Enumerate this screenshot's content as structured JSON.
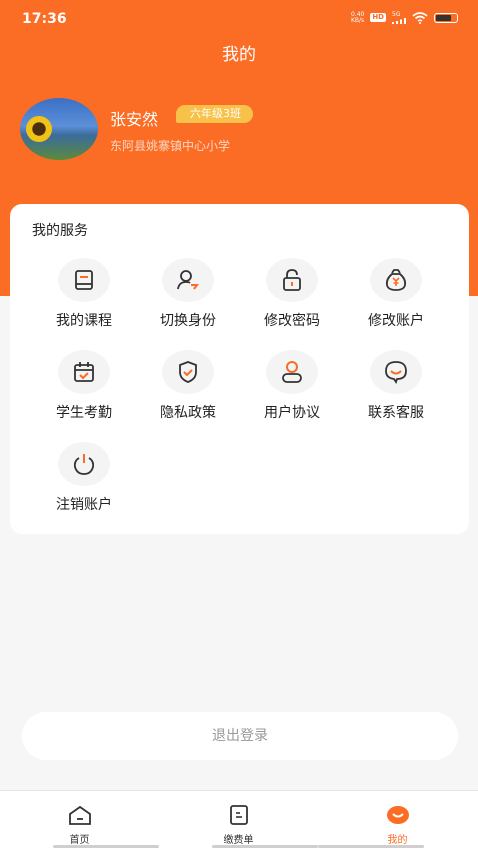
{
  "status_bar": {
    "time": "17:36",
    "net_speed_top": "0.40",
    "net_speed_bottom": "KB/s",
    "hd": "HD",
    "network": "5G"
  },
  "header": {
    "title": "我的"
  },
  "user": {
    "name": "张安然",
    "class_badge": "六年级3班",
    "school": "东阿县姚寨镇中心小学"
  },
  "services": {
    "title": "我的服务",
    "items": [
      {
        "label": "我的课程",
        "icon": "book-icon"
      },
      {
        "label": "切换身份",
        "icon": "switch-user-icon"
      },
      {
        "label": "修改密码",
        "icon": "lock-icon"
      },
      {
        "label": "修改账户",
        "icon": "money-bag-icon"
      },
      {
        "label": "学生考勤",
        "icon": "calendar-check-icon"
      },
      {
        "label": "隐私政策",
        "icon": "shield-check-icon"
      },
      {
        "label": "用户协议",
        "icon": "user-icon"
      },
      {
        "label": "联系客服",
        "icon": "chat-icon"
      },
      {
        "label": "注销账户",
        "icon": "power-icon"
      }
    ]
  },
  "logout": {
    "label": "退出登录"
  },
  "tab_bar": {
    "tabs": [
      {
        "label": "首页",
        "icon": "home-icon"
      },
      {
        "label": "缴费单",
        "icon": "bill-icon"
      },
      {
        "label": "我的",
        "icon": "profile-icon"
      }
    ]
  },
  "colors": {
    "brand": "#fb6c25",
    "badge": "#f8c24a",
    "background": "#f6f6f6"
  }
}
